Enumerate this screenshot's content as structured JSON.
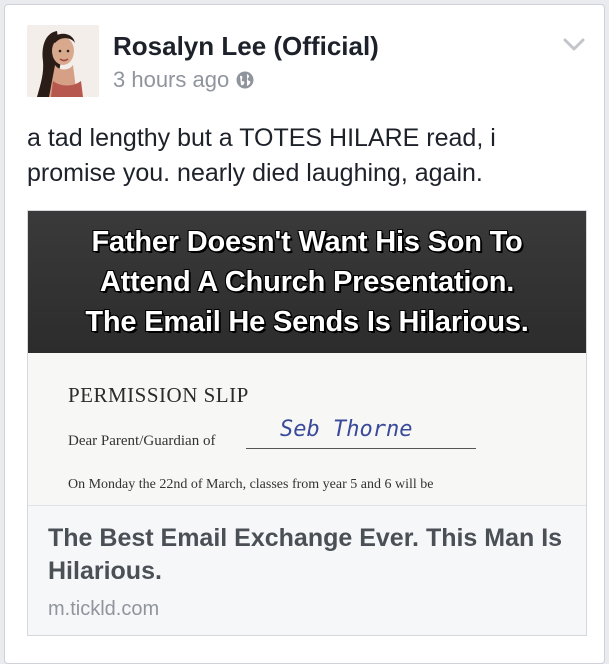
{
  "post": {
    "author": "Rosalyn Lee (Official)",
    "time": "3 hours ago",
    "privacy_icon": "globe-icon",
    "menu_icon": "chevron-down-icon",
    "text": "a tad lengthy but a TOTES HILARE read, i promise you. nearly died laughing, again."
  },
  "link": {
    "thumbnail": {
      "banner_lines": [
        "Father Doesn't Want His Son To",
        "Attend A Church Presentation.",
        "The Email He Sends Is Hilarious."
      ],
      "slip_title": "PERMISSION SLIP",
      "slip_dear": "Dear Parent/Guardian of",
      "slip_name": "Seb Thorne",
      "slip_body": "On Monday the 22nd of March, classes from year 5 and 6 will be"
    },
    "title": "The Best Email Exchange Ever. This Man Is Hilarious.",
    "domain": "m.tickld.com"
  },
  "colors": {
    "author": "#1d2129",
    "meta": "#90949c",
    "banner_bg": "#2c2c2c",
    "link_title": "#4b4f56",
    "handwriting": "#3a4a9a"
  }
}
